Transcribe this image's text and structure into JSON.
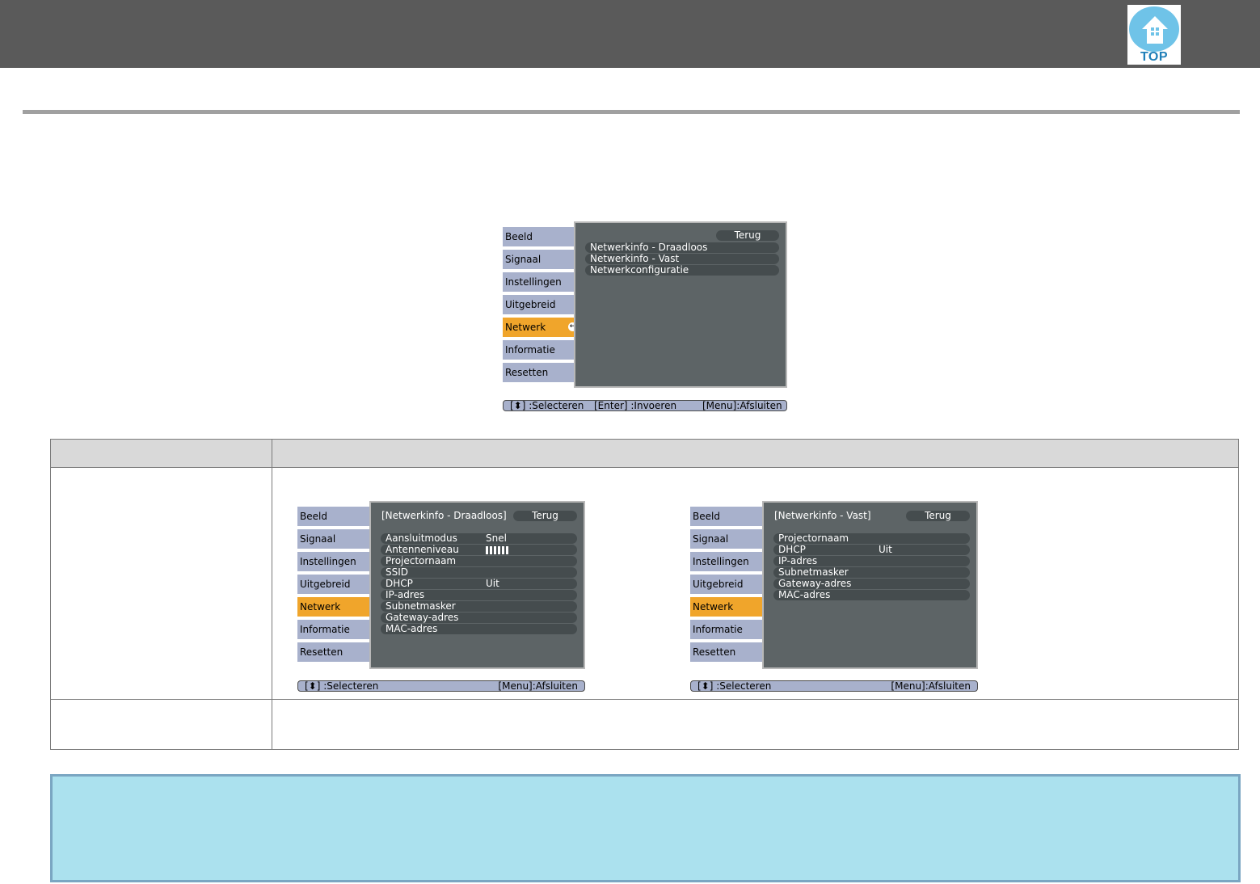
{
  "header": {
    "top_label": "TOP"
  },
  "main_menu": {
    "tabs": [
      "Beeld",
      "Signaal",
      "Instellingen",
      "Uitgebreid",
      "Netwerk",
      "Informatie",
      "Resetten"
    ],
    "selected_tab": "Netwerk",
    "back_label": "Terug",
    "items": [
      "Netwerkinfo - Draadloos",
      "Netwerkinfo - Vast",
      "Netwerkconfiguratie"
    ],
    "help": {
      "select": "[⬍] :Selecteren",
      "enter": "[Enter] :Invoeren",
      "exit": "[Menu]:Afsluiten"
    }
  },
  "wireless_menu": {
    "title": "[Netwerkinfo - Draadloos]",
    "back_label": "Terug",
    "rows": [
      {
        "label": "Aansluitmodus",
        "value": "Snel"
      },
      {
        "label": "Antenneniveau",
        "value": ""
      },
      {
        "label": "Projectornaam",
        "value": ""
      },
      {
        "label": "SSID",
        "value": ""
      },
      {
        "label": "DHCP",
        "value": "Uit"
      },
      {
        "label": "IP-adres",
        "value": ""
      },
      {
        "label": "Subnetmasker",
        "value": ""
      },
      {
        "label": "Gateway-adres",
        "value": ""
      },
      {
        "label": "MAC-adres",
        "value": ""
      }
    ],
    "antenna_level": 5,
    "help": {
      "select": "[⬍] :Selecteren",
      "exit": "[Menu]:Afsluiten"
    }
  },
  "wired_menu": {
    "title": "[Netwerkinfo - Vast]",
    "back_label": "Terug",
    "rows": [
      {
        "label": "Projectornaam",
        "value": ""
      },
      {
        "label": "DHCP",
        "value": "Uit"
      },
      {
        "label": "IP-adres",
        "value": ""
      },
      {
        "label": "Subnetmasker",
        "value": ""
      },
      {
        "label": "Gateway-adres",
        "value": ""
      },
      {
        "label": "MAC-adres",
        "value": ""
      }
    ],
    "help": {
      "select": "[⬍] :Selecteren",
      "exit": "[Menu]:Afsluiten"
    }
  },
  "colors": {
    "tab": "#a8b1cc",
    "tab_selected": "#f0a52b",
    "panel": "#5d6466",
    "note_bg": "#abe1ee",
    "header_bg": "#5a5a5a"
  }
}
